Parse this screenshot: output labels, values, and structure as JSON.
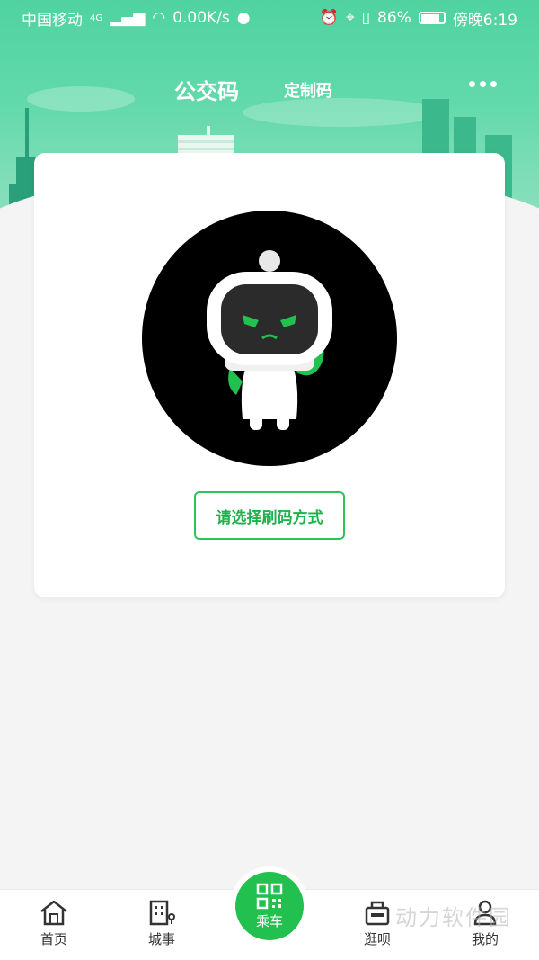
{
  "status_bar": {
    "carrier": "中国移动",
    "network": "4G",
    "speed": "0.00K/s",
    "battery": "86%",
    "time": "傍晚6:19"
  },
  "header": {
    "title": "公交码",
    "subtitle": "定制码"
  },
  "card": {
    "choose_button": "请选择刷码方式"
  },
  "tab_bar": {
    "items": [
      {
        "label": "首页",
        "icon": "home-icon"
      },
      {
        "label": "城事",
        "icon": "building-icon"
      },
      {
        "label": "乘车",
        "icon": "qr-code-icon"
      },
      {
        "label": "逛呗",
        "icon": "shop-icon"
      },
      {
        "label": "我的",
        "icon": "user-icon"
      }
    ]
  },
  "watermark": "动力软件园",
  "colors": {
    "accent_green": "#21c04f",
    "header_green": "#4fd3a0"
  }
}
